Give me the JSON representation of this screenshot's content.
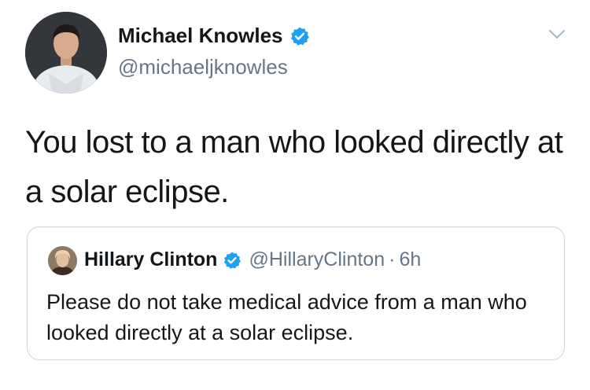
{
  "tweet": {
    "author": {
      "name": "Michael Knowles",
      "handle": "@michaeljknowles",
      "verified": true,
      "avatar": "profile-photo-man-in-white-shirt"
    },
    "text": "You lost to a man who looked directly at a solar eclipse.",
    "menu_icon": "chevron-down-icon"
  },
  "quoted_tweet": {
    "author": {
      "name": "Hillary Clinton",
      "handle": "@HillaryClinton",
      "verified": true,
      "avatar": "profile-photo-woman"
    },
    "separator": "·",
    "time": "6h",
    "text": "Please do not take medical advice from a man who looked directly at a solar eclipse."
  },
  "colors": {
    "text": "#14171a",
    "secondary": "#657786",
    "verified_badge": "#1da1f2",
    "border": "#ccd6dd"
  }
}
